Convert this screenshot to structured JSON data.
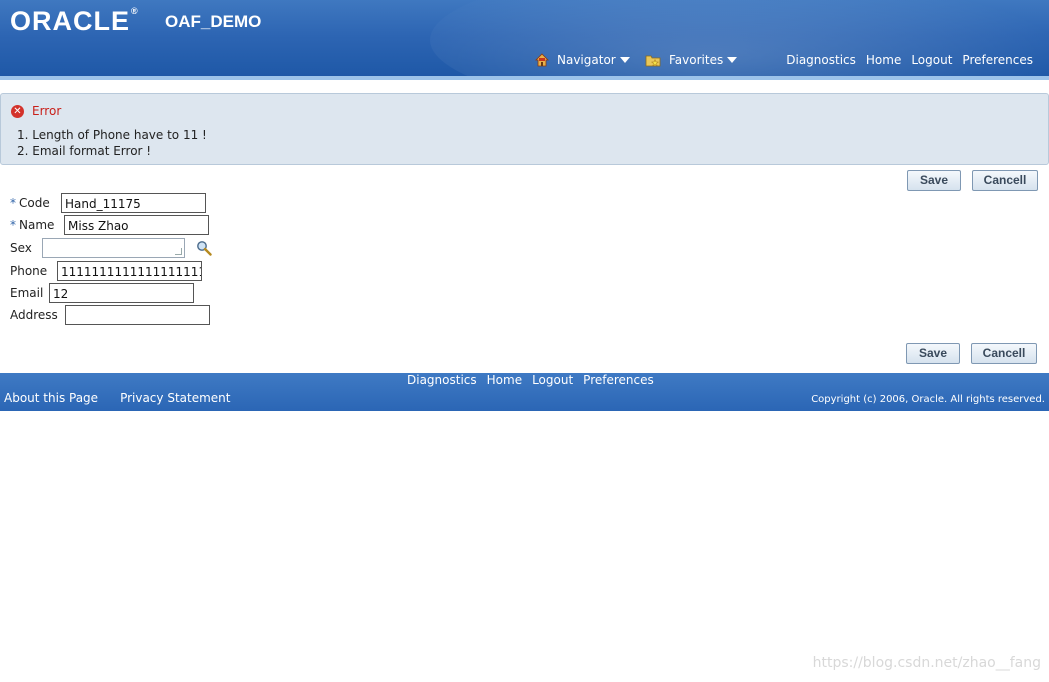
{
  "header": {
    "logo_text": "ORACLE",
    "logo_reg": "®",
    "app_name": "OAF_DEMO",
    "navigator_label": "Navigator",
    "favorites_label": "Favorites",
    "links": [
      "Diagnostics",
      "Home",
      "Logout",
      "Preferences"
    ]
  },
  "error": {
    "title": "Error",
    "messages": [
      "1. Length of Phone have to 11 !",
      "2. Email format Error !"
    ]
  },
  "buttons": {
    "save_label": "Save",
    "cancel_label": "Cancell"
  },
  "form": {
    "code_label": "Code",
    "code_value": "Hand_11175",
    "name_label": "Name",
    "name_value": "Miss Zhao",
    "sex_label": "Sex",
    "sex_value": "",
    "phone_label": "Phone",
    "phone_value": "1111111111111111111",
    "email_label": "Email",
    "email_value": "12",
    "address_label": "Address",
    "address_value": "",
    "required_marker": "*"
  },
  "footer": {
    "links": [
      "Diagnostics",
      "Home",
      "Logout",
      "Preferences"
    ],
    "about": "About this Page",
    "privacy": "Privacy Statement",
    "copyright": "Copyright (c) 2006, Oracle. All rights reserved."
  },
  "watermark": "https://blog.csdn.net/zhao__fang"
}
